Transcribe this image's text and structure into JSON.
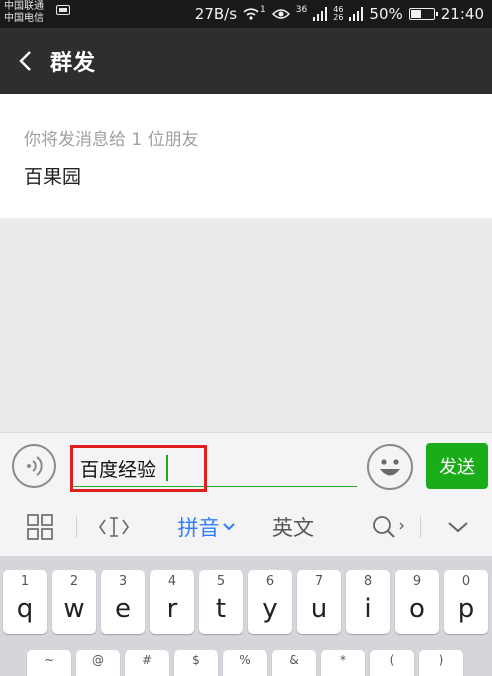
{
  "status_bar": {
    "carrier_1": "中国联通",
    "carrier_2": "中国电信",
    "speed": "27B/s",
    "wifi_label": "1",
    "network_1": "36",
    "network_2": "46",
    "network_3": "26",
    "battery_percent": "50%",
    "battery_level": 0.5,
    "time": "21:40"
  },
  "title_bar": {
    "title": "群发"
  },
  "recipients": {
    "hint": "你将发消息给 1 位朋友",
    "names": "百果园"
  },
  "input_bar": {
    "message_value": "百度经验",
    "send_label": "发送",
    "accent_color": "#1aad19",
    "highlight_color": "#e0201e"
  },
  "ime_toolbar": {
    "pinyin_label": "拼音",
    "english_label": "英文"
  },
  "keyboard": {
    "row1": [
      {
        "num": "1",
        "letter": "q"
      },
      {
        "num": "2",
        "letter": "w"
      },
      {
        "num": "3",
        "letter": "e"
      },
      {
        "num": "4",
        "letter": "r"
      },
      {
        "num": "5",
        "letter": "t"
      },
      {
        "num": "6",
        "letter": "y"
      },
      {
        "num": "7",
        "letter": "u"
      },
      {
        "num": "8",
        "letter": "i"
      },
      {
        "num": "9",
        "letter": "o"
      },
      {
        "num": "0",
        "letter": "p"
      }
    ],
    "row2_symbols": [
      "~",
      "@",
      "#",
      "$",
      "%",
      "&",
      "*",
      "(",
      ")"
    ]
  }
}
